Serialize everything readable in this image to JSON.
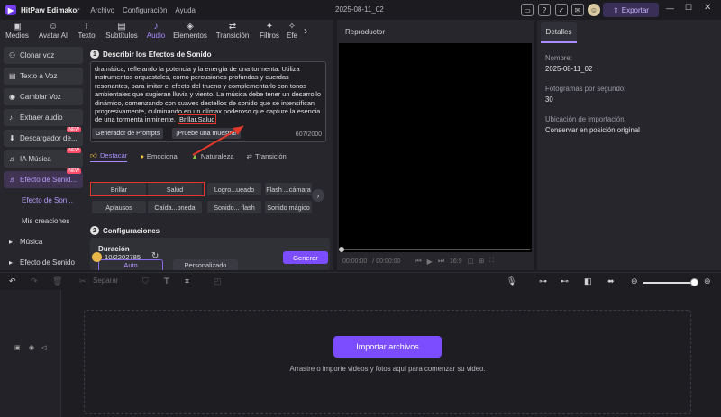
{
  "app": {
    "name": "HitPaw Edimakor",
    "menu": [
      "Archivo",
      "Configuración",
      "Ayuda"
    ],
    "project_name": "2025-08-11_02",
    "export_label": "Exportar"
  },
  "top_tabs": [
    {
      "label": "Medios",
      "icon": "media-icon"
    },
    {
      "label": "Avatar AI",
      "icon": "avatar-icon"
    },
    {
      "label": "Texto",
      "icon": "text-icon"
    },
    {
      "label": "Subtítulos",
      "icon": "subtitles-icon"
    },
    {
      "label": "Audio",
      "icon": "audio-icon",
      "active": true
    },
    {
      "label": "Elementos",
      "icon": "elements-icon"
    },
    {
      "label": "Transición",
      "icon": "transition-icon"
    },
    {
      "label": "Filtros",
      "icon": "filters-icon"
    },
    {
      "label": "Efe",
      "icon": "effects-icon"
    }
  ],
  "sidebar": {
    "items": [
      {
        "label": "Clonar voz",
        "icon": "clone-voice-icon"
      },
      {
        "label": "Texto a Voz",
        "icon": "text-to-speech-icon"
      },
      {
        "label": "Cambiar Voz",
        "icon": "change-voice-icon"
      },
      {
        "label": "Extraer audio",
        "icon": "extract-audio-icon"
      },
      {
        "label": "Descargador de...",
        "icon": "downloader-icon",
        "badge": "NEW"
      },
      {
        "label": "IA Música",
        "icon": "ai-music-icon",
        "badge": "NEW"
      },
      {
        "label": "Efecto de Sonid...",
        "icon": "sound-effect-icon",
        "badge": "NEW",
        "active": true
      },
      {
        "label": "Efecto de Son...",
        "sub": true,
        "active": true
      },
      {
        "label": "Mis creaciones",
        "sub": true
      },
      {
        "label": "Música",
        "icon": "expand-icon"
      },
      {
        "label": "Efecto de Sonido",
        "icon": "expand-icon"
      }
    ]
  },
  "describe": {
    "step": "1",
    "title": "Describir los Efectos de Sonido",
    "prompt_text": "dramática, reflejando la potencia y la energía de una tormenta. Utiliza instrumentos orquestales, como percusiones profundas y cuerdas resonantes, para imitar el efecto del trueno y complementarlo con tonos ambientales que sugieran lluvia y viento. La música debe tener un desarrollo dinámico, comenzando con suaves destellos de sonido que se intensifican progresivamente, culminando en un clímax poderoso que capture la esencia de una tormenta inminente.",
    "highlight_text": "Brillar,Salud",
    "count": "607/2000",
    "btn_generator": "Generador de Prompts",
    "btn_try": "¡Pruebe una muestra!"
  },
  "category_tabs": [
    {
      "label": "Destacar",
      "icon": "thumbs-up-icon",
      "active": true
    },
    {
      "label": "Emocional",
      "icon": "emoji-icon"
    },
    {
      "label": "Naturaleza",
      "icon": "nature-icon"
    },
    {
      "label": "Transición",
      "icon": "transition-icon"
    }
  ],
  "tags": [
    "Brillar",
    "Salud",
    "Logro...ueado",
    "Flash ...cámara",
    "Aplausos",
    "Caída...oneda",
    "Sonido... flash",
    "Sonido mágico"
  ],
  "config": {
    "step": "2",
    "title": "Configuraciones",
    "duration_label": "Duración",
    "auto_label": "Auto",
    "custom_label": "Personalizado"
  },
  "credits": "10/2202785",
  "generate_label": "Generar",
  "preview": {
    "title": "Reproductor",
    "time_current": "00:00:00",
    "time_total": "00:00:00",
    "ratio": "16:9"
  },
  "details": {
    "tab": "Detalles",
    "fields": [
      {
        "label": "Nombre:",
        "value": "2025-08-11_02"
      },
      {
        "label": "Fotogramas por segundo:",
        "value": "30"
      },
      {
        "label": "Ubicación de importación:",
        "value": "Conservar en posición original"
      }
    ]
  },
  "timeline": {
    "split_label": "Separar",
    "import_label": "Importar archivos",
    "hint": "Arrastre o importe videos y fotos aquí para comenzar su video."
  },
  "colors": {
    "accent": "#7c4dff",
    "highlight_box": "#e0392c"
  }
}
